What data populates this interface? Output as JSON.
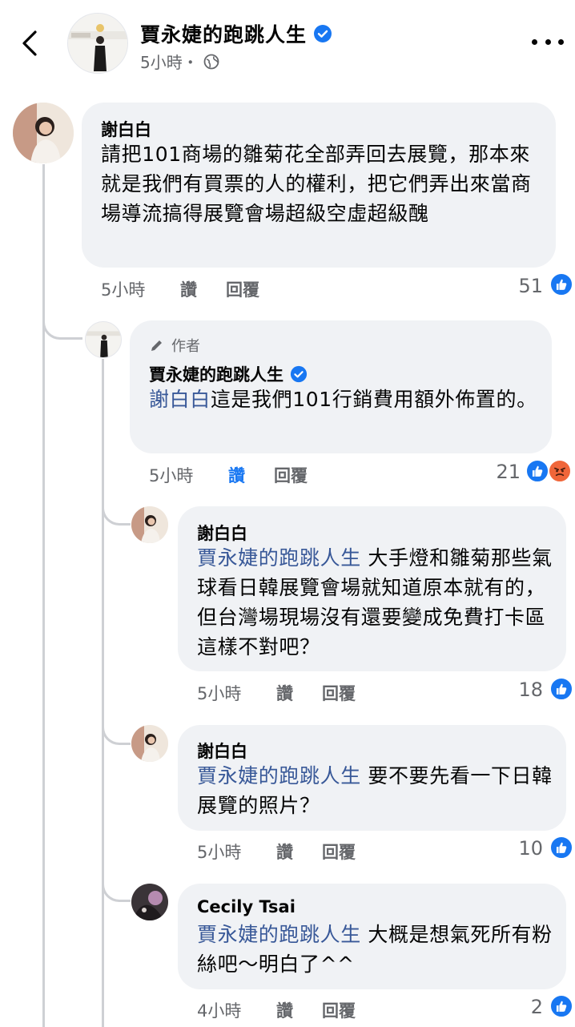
{
  "header": {
    "page_name": "賈永婕的跑跳人生",
    "time": "5小時・"
  },
  "actions": {
    "like": "讚",
    "reply": "回覆"
  },
  "comments": [
    {
      "author": "謝白白",
      "text": "請把101商場的雛菊花全部弄回去展覽，那本來就是我們有買票的人的權利，把它們弄出來當商場導流搞得展覽會場超級空虛超級醜",
      "time": "5小時",
      "reaction_count": "51"
    },
    {
      "author_tag": "作者",
      "author": "賈永婕的跑跳人生",
      "mention": "謝白白",
      "text": "這是我們101行銷費用額外佈置的。",
      "time": "5小時",
      "reaction_count": "21"
    },
    {
      "author": "謝白白",
      "mention": "賈永婕的跑跳人生",
      "text": " 大手燈和雛菊那些氣球看日韓展覽會場就知道原本就有的，但台灣場現場沒有還要變成免費打卡區這樣不對吧？",
      "time": "5小時",
      "reaction_count": "18"
    },
    {
      "author": "謝白白",
      "mention": "賈永婕的跑跳人生",
      "text": " 要不要先看一下日韓展覽的照片？",
      "time": "5小時",
      "reaction_count": "10"
    },
    {
      "author": "Cecily Tsai",
      "mention": "賈永婕的跑跳人生",
      "text": " 大概是想氣死所有粉絲吧～明白了^^",
      "time": "4小時",
      "reaction_count": "2"
    }
  ],
  "colors": {
    "accent": "#1877f2",
    "mention": "#385898",
    "bubble": "#f0f2f5",
    "meta": "#65676b"
  },
  "icons": [
    "back-arrow-icon",
    "verified-badge-icon",
    "globe-icon",
    "more-icon",
    "pen-icon",
    "like-reaction-icon",
    "angry-reaction-icon"
  ]
}
